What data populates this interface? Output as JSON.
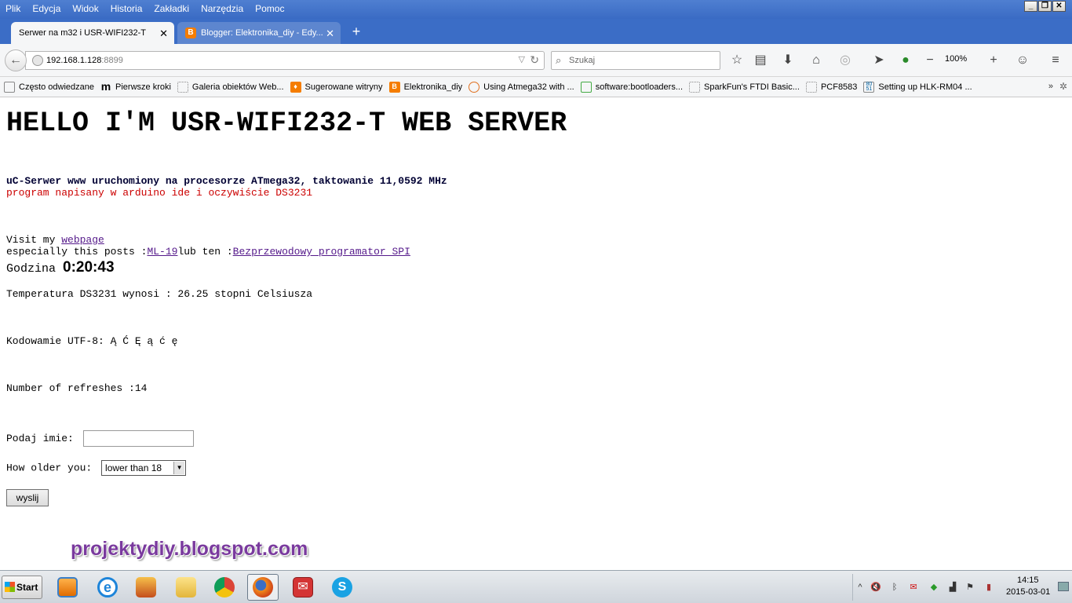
{
  "menubar": {
    "items": [
      "Plik",
      "Edycja",
      "Widok",
      "Historia",
      "Zakładki",
      "Narzędzia",
      "Pomoc"
    ],
    "window_controls": [
      "_",
      "❐",
      "✕"
    ]
  },
  "tabs": [
    {
      "title": "Serwer na m32 i USR-WIFI232-T",
      "close": "✕"
    },
    {
      "title": "Blogger: Elektronika_diy - Edy...",
      "close": "✕",
      "favicon": "B"
    }
  ],
  "new_tab": "+",
  "nav": {
    "url_host": "192.168.1.128",
    "url_port": ":8899",
    "search_placeholder": "Szukaj",
    "zoom": "100%"
  },
  "bookmarks": [
    {
      "label": "Często odwiedzane",
      "icon": "folder-icon"
    },
    {
      "label": "Pierwsze kroki",
      "icon": "mozilla-icon"
    },
    {
      "label": "Galeria obiektów Web...",
      "icon": "page-icon"
    },
    {
      "label": "Sugerowane witryny",
      "icon": "bulb-icon"
    },
    {
      "label": "Elektronika_diy",
      "icon": "blogger-icon"
    },
    {
      "label": "Using Atmega32 with ...",
      "icon": "atmel-icon"
    },
    {
      "label": "software:bootloaders...",
      "icon": "doc-icon"
    },
    {
      "label": "SparkFun's FTDI Basic...",
      "icon": "page-icon"
    },
    {
      "label": "PCF8583",
      "icon": "page-icon"
    },
    {
      "label": "Setting up HLK-RM04 ...",
      "icon": "8051-icon"
    }
  ],
  "bookmarks_overflow": "»",
  "page": {
    "heading": "HELLO I'M USR-WIFI232-T WEB SERVER",
    "info_line1": "uC-Serwer www uruchomiony na procesorze ATmega32, taktowanie 11,0592 MHz",
    "info_line2": "program napisany w arduino ide i oczywiście DS3231",
    "visit_prefix": "Visit my ",
    "visit_link": "webpage",
    "posts_prefix": "especially this posts :",
    "posts_link1": "ML-19",
    "posts_mid": "lub ten :",
    "posts_link2": "Bezprzewodowy programator SPI",
    "godzina_label": "Godzina ",
    "time": "0:20:43",
    "temperature": "Temperatura DS3231 wynosi : 26.25 stopni Celsiusza",
    "encoding": "Kodowamie UTF-8: Ą Ć Ę ą ć ę",
    "refreshes": "Number of refreshes :14",
    "name_label": "Podaj imie:",
    "name_value": "",
    "age_label": "How older you:",
    "age_selected": "lower than 18",
    "submit": "wyslij",
    "watermark": "projektydiy.blogspot.com"
  },
  "taskbar": {
    "start": "Start",
    "apps": [
      "media-player-icon",
      "ie-icon",
      "installer-icon",
      "explorer-icon",
      "chrome-icon",
      "firefox-icon",
      "mail-icon",
      "skype-icon"
    ],
    "time": "14:15",
    "date": "2015-03-01"
  }
}
